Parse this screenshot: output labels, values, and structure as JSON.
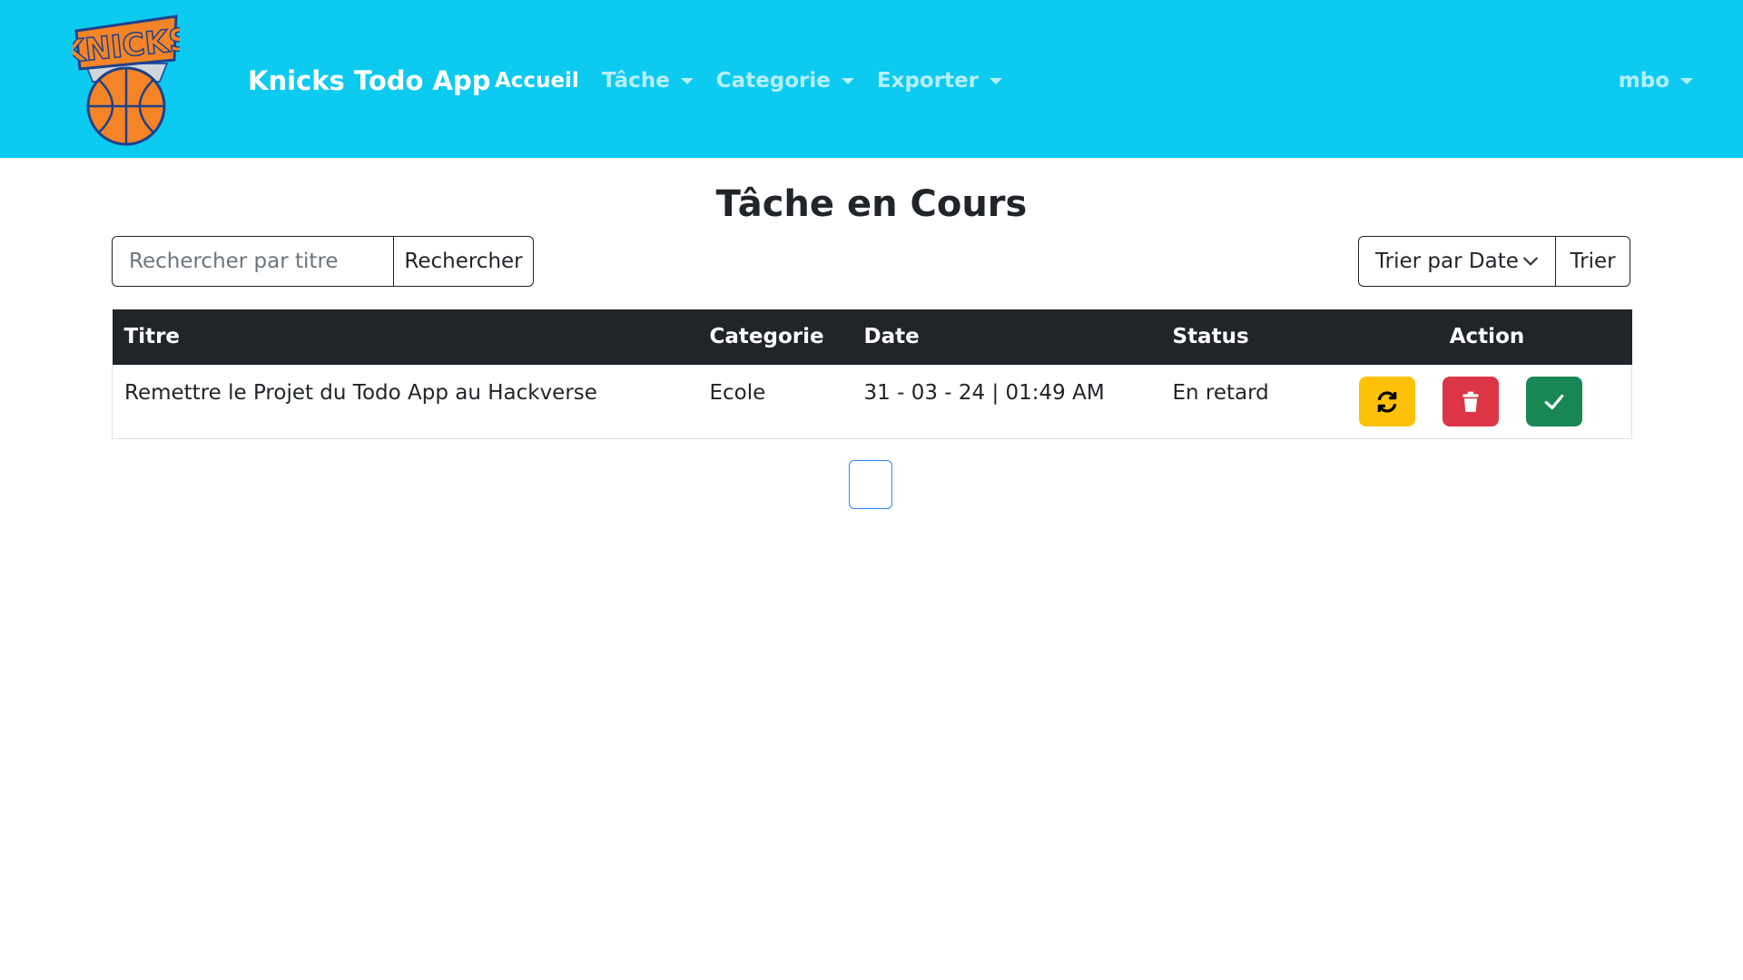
{
  "navbar": {
    "logo_alt": "KNICKS",
    "brand": "Knicks Todo App",
    "items": [
      {
        "label": "Accueil",
        "active": true,
        "dropdown": false
      },
      {
        "label": "Tâche",
        "active": false,
        "dropdown": true
      },
      {
        "label": "Categorie",
        "active": false,
        "dropdown": true
      },
      {
        "label": "Exporter",
        "active": false,
        "dropdown": true
      }
    ],
    "user": "mbo"
  },
  "main": {
    "title": "Tâche en Cours",
    "search": {
      "placeholder": "Rechercher par titre",
      "value": "",
      "button": "Rechercher"
    },
    "sort": {
      "selected": "Trier par Date",
      "button": "Trier"
    },
    "table": {
      "headers": [
        "Titre",
        "Categorie",
        "Date",
        "Status",
        "Action"
      ],
      "rows": [
        {
          "titre": "Remettre le Projet du Todo App au Hackverse",
          "categorie": "Ecole",
          "date": "31 - 03 - 24 | 01:49 AM",
          "status": "En retard"
        }
      ]
    }
  },
  "colors": {
    "navbar": "#0dcaf0",
    "warning": "#ffc107",
    "danger": "#dc3545",
    "success": "#198754",
    "table_head": "#212529"
  }
}
